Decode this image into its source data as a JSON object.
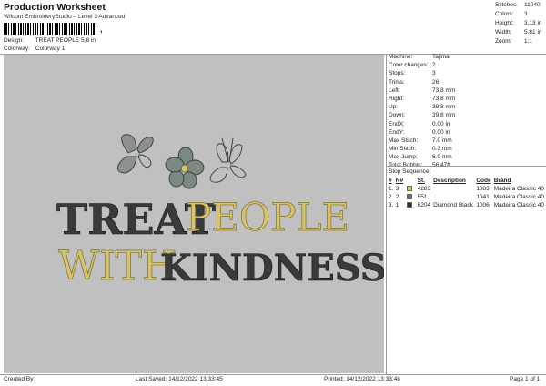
{
  "header": {
    "title": "Production Worksheet",
    "subtitle": "Wilcom EmbroideryStudio – Level 3 Advanced",
    "barcode_mark": ","
  },
  "design": {
    "label": "Design:",
    "value": "TREAT PEOPLE 5,8 in"
  },
  "colorway": {
    "label": "Colorway:",
    "value": "Colorway 1"
  },
  "stats": [
    {
      "label": "Stitches:",
      "value": "11040"
    },
    {
      "label": "Colors:",
      "value": "3"
    },
    {
      "label": "Height:",
      "value": "3.13 in"
    },
    {
      "label": "Width:",
      "value": "5.81 in"
    },
    {
      "label": "Zoom:",
      "value": "1:1"
    }
  ],
  "properties": [
    {
      "label": "Machine:",
      "value": "Tajima"
    },
    {
      "label": "Color changes:",
      "value": "2"
    },
    {
      "label": "Stops:",
      "value": "3"
    },
    {
      "label": "Trims:",
      "value": "26"
    },
    {
      "label": "Left:",
      "value": "73.8 mm"
    },
    {
      "label": "Right:",
      "value": "73.8 mm"
    },
    {
      "label": "Up:",
      "value": "39.8 mm"
    },
    {
      "label": "Down:",
      "value": "39.8 mm"
    },
    {
      "label": "EndX:",
      "value": "0.00 in"
    },
    {
      "label": "EndY:",
      "value": "0.00 in"
    },
    {
      "label": "Max Stitch:",
      "value": "7.0 mm"
    },
    {
      "label": "Min Stitch:",
      "value": "0.3 mm"
    },
    {
      "label": "Max Jump:",
      "value": "6.9 mm"
    },
    {
      "label": "Total Bobbin:",
      "value": "56.47ft"
    }
  ],
  "stop_sequence": {
    "title": "Stop Sequence:",
    "headers": {
      "index": "#",
      "n": "N#",
      "st": "St.",
      "description": "Description",
      "code": "Code",
      "brand": "Brand"
    },
    "rows": [
      {
        "index": "1.",
        "n": "3",
        "color": "#d8c36a",
        "st": "4283",
        "description": "",
        "code": "1083",
        "brand": "Madeira Classic 40"
      },
      {
        "index": "2.",
        "n": "2",
        "color": "#707070",
        "st": "551",
        "description": "",
        "code": "1041",
        "brand": "Madeira Classic 40"
      },
      {
        "index": "3.",
        "n": "1",
        "color": "#2a2a2a",
        "st": "6204",
        "description": "Diamond Black",
        "code": "1006",
        "brand": "Madeira Classic 40"
      }
    ]
  },
  "artwork": {
    "line1_dark": "TREAT",
    "line1_gold": "PEOPLE",
    "line2_gold": "WITH",
    "line2_dark": "KINDNESS",
    "colors": {
      "canvas": "#c0c0c0",
      "dark": "#3a3a3a",
      "gold": "#d8c36a",
      "flower": "#7a8a80"
    }
  },
  "footer": {
    "created_by": "Created By:",
    "last_saved": "Last Saved: 14/12/2022 13:33:45",
    "printed": "Printed: 14/12/2022 13:33:48",
    "page": "Page 1 of 1"
  }
}
